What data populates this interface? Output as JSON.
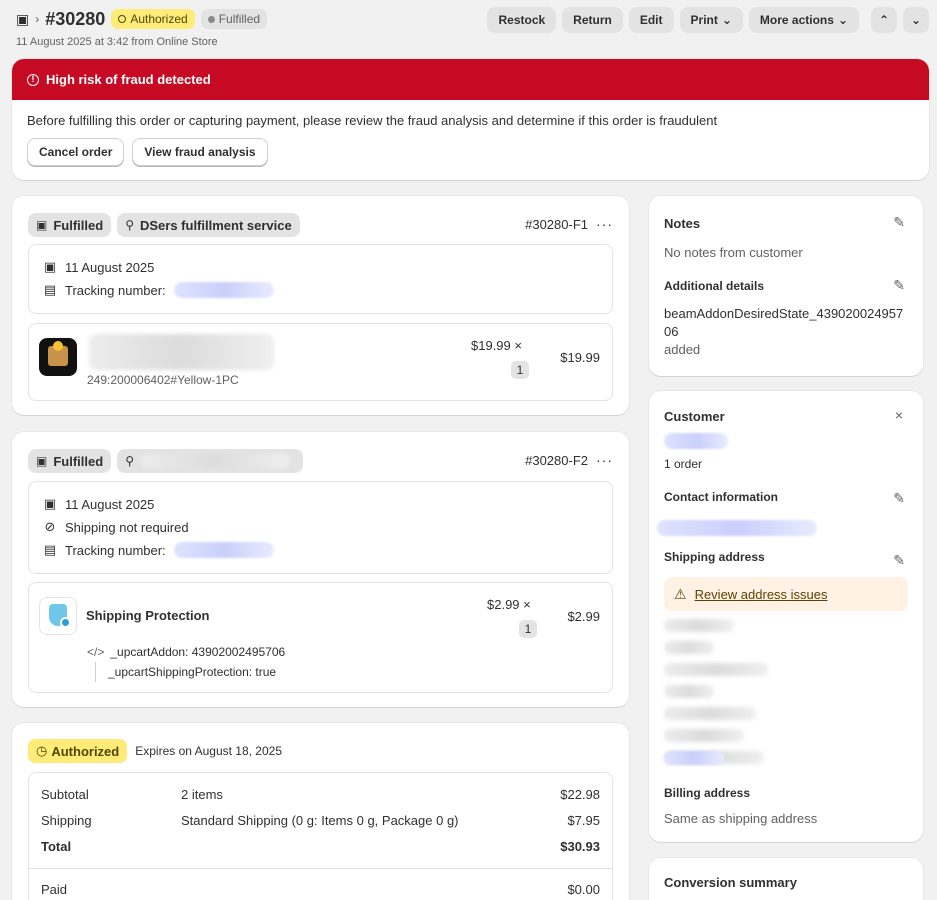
{
  "header": {
    "order_number": "#30280",
    "badge_authorized": "Authorized",
    "badge_fulfilled": "Fulfilled",
    "subline": "11 August 2025 at 3:42 from Online Store",
    "actions": {
      "restock": "Restock",
      "return": "Return",
      "edit": "Edit",
      "print": "Print",
      "more": "More actions"
    }
  },
  "fraud": {
    "title": "High risk of fraud detected",
    "text": "Before fulfilling this order or capturing payment, please review the fraud analysis and determine if this order is fraudulent",
    "cancel_btn": "Cancel order",
    "view_btn": "View fraud analysis"
  },
  "fulfillment1": {
    "status": "Fulfilled",
    "location": "DSers fulfillment service",
    "ref": "#30280-F1",
    "date": "11 August 2025",
    "tracking_label": "Tracking number:",
    "product": {
      "variant": "249:200006402#Yellow-1PC",
      "unit_price": "$19.99 ×",
      "qty": "1",
      "total": "$19.99"
    }
  },
  "fulfillment2": {
    "status": "Fulfilled",
    "ref": "#30280-F2",
    "date": "11 August 2025",
    "shipping_note": "Shipping not required",
    "tracking_label": "Tracking number:",
    "product": {
      "name": "Shipping Protection",
      "unit_price": "$2.99 ×",
      "qty": "1",
      "total": "$2.99",
      "prop1": "_upcartAddon: 43902002495706",
      "prop2": "_upcartShippingProtection: true"
    }
  },
  "payment": {
    "badge": "Authorized",
    "expires": "Expires on August 18, 2025",
    "rows": [
      {
        "label": "Subtotal",
        "desc": "2 items",
        "amount": "$22.98"
      },
      {
        "label": "Shipping",
        "desc": "Standard Shipping (0 g: Items 0 g, Package 0 g)",
        "amount": "$7.95"
      },
      {
        "label": "Total",
        "desc": "",
        "amount": "$30.93"
      }
    ],
    "paid_label": "Paid",
    "paid_amount": "$0.00"
  },
  "notes": {
    "title": "Notes",
    "text": "No notes from customer",
    "additional_title": "Additional details",
    "additional_line1": "beamAddonDesiredState_439020024957",
    "additional_line2": "06",
    "additional_line3": "added"
  },
  "customer": {
    "title": "Customer",
    "orders": "1 order",
    "contact_title": "Contact information",
    "shipping_title": "Shipping address",
    "review_link": "Review address issues",
    "billing_title": "Billing address",
    "billing_text": "Same as shipping address"
  },
  "conversion": {
    "title": "Conversion summary"
  },
  "colors": {
    "fraud_red": "#c70a24",
    "authorized_yellow": "#ffeb78",
    "warn_bg": "#fff1e3"
  }
}
